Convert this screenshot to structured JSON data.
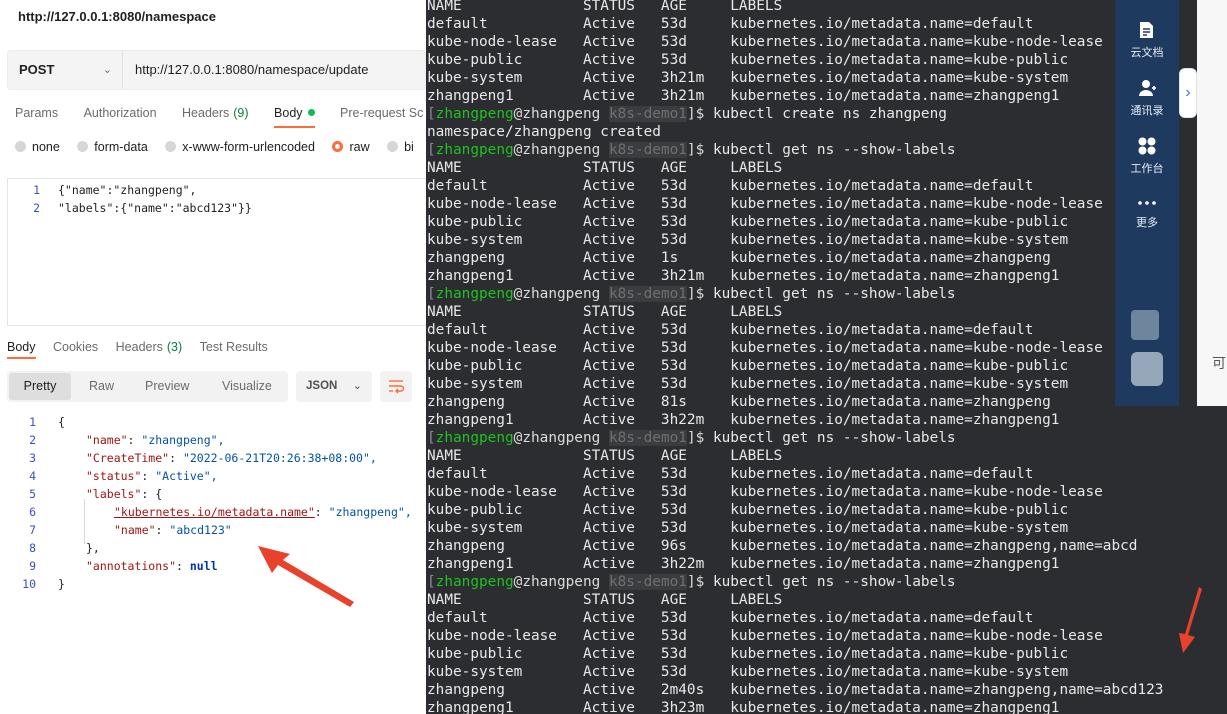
{
  "postman": {
    "request_title": "http://127.0.0.1:8080/namespace",
    "method": "POST",
    "url": "http://127.0.0.1:8080/namespace/update",
    "req_tabs": [
      {
        "label": "Params"
      },
      {
        "label": "Authorization"
      },
      {
        "label": "Headers",
        "count": "(9)"
      },
      {
        "label": "Body"
      },
      {
        "label": "Pre-request Sc"
      }
    ],
    "body_types": [
      "none",
      "form-data",
      "x-www-form-urlencoded",
      "raw",
      "bi"
    ],
    "body_type_selected": "raw",
    "body_lines": [
      {
        "n": "1",
        "text": "{\"name\":\"zhangpeng\","
      },
      {
        "n": "2",
        "text": "\"labels\":{\"name\":\"abcd123\"}}"
      }
    ],
    "resp_tabs": [
      {
        "label": "Body"
      },
      {
        "label": "Cookies"
      },
      {
        "label": "Headers",
        "count": "(3)"
      },
      {
        "label": "Test Results"
      }
    ],
    "view_modes": [
      "Pretty",
      "Raw",
      "Preview",
      "Visualize"
    ],
    "format": "JSON",
    "response_lines": [
      {
        "n": "1",
        "text": "{"
      },
      {
        "n": "2",
        "key": "\"name\"",
        "val": "\"zhangpeng\","
      },
      {
        "n": "3",
        "key": "\"CreateTime\"",
        "val": "\"2022-06-21T20:26:38+08:00\","
      },
      {
        "n": "4",
        "key": "\"status\"",
        "val": "\"Active\","
      },
      {
        "n": "5",
        "key": "\"labels\"",
        "val": "{"
      },
      {
        "n": "6",
        "key": "\"kubernetes.io/metadata.name\"",
        "val": "\"zhangpeng\","
      },
      {
        "n": "7",
        "key": "\"name\"",
        "val": "\"abcd123\""
      },
      {
        "n": "8",
        "text": "},"
      },
      {
        "n": "9",
        "key": "\"annotations\"",
        "val": "null"
      },
      {
        "n": "10",
        "text": "}"
      }
    ]
  },
  "terminal": {
    "lines": [
      {
        "t": "out",
        "text": "NAME              STATUS   AGE     LABELS"
      },
      {
        "t": "out",
        "text": "default           Active   53d     kubernetes.io/metadata.name=default"
      },
      {
        "t": "out",
        "text": "kube-node-lease   Active   53d     kubernetes.io/metadata.name=kube-node-lease"
      },
      {
        "t": "out",
        "text": "kube-public       Active   53d     kubernetes.io/metadata.name=kube-public"
      },
      {
        "t": "out",
        "text": "kube-system       Active   3h21m   kubernetes.io/metadata.name=kube-system"
      },
      {
        "t": "out",
        "text": "zhangpeng1        Active   3h21m   kubernetes.io/metadata.name=zhangpeng1"
      },
      {
        "t": "cmd",
        "cmd": "kubectl create ns zhangpeng"
      },
      {
        "t": "out",
        "text": "namespace/zhangpeng created"
      },
      {
        "t": "cmd",
        "cmd": "kubectl get ns --show-labels"
      },
      {
        "t": "out",
        "text": "NAME              STATUS   AGE     LABELS"
      },
      {
        "t": "out",
        "text": "default           Active   53d     kubernetes.io/metadata.name=default"
      },
      {
        "t": "out",
        "text": "kube-node-lease   Active   53d     kubernetes.io/metadata.name=kube-node-lease"
      },
      {
        "t": "out",
        "text": "kube-public       Active   53d     kubernetes.io/metadata.name=kube-public"
      },
      {
        "t": "out",
        "text": "kube-system       Active   53d     kubernetes.io/metadata.name=kube-system"
      },
      {
        "t": "out",
        "text": "zhangpeng         Active   1s      kubernetes.io/metadata.name=zhangpeng"
      },
      {
        "t": "out",
        "text": "zhangpeng1        Active   3h21m   kubernetes.io/metadata.name=zhangpeng1"
      },
      {
        "t": "cmd",
        "cmd": "kubectl get ns --show-labels"
      },
      {
        "t": "out",
        "text": "NAME              STATUS   AGE     LABELS"
      },
      {
        "t": "out",
        "text": "default           Active   53d     kubernetes.io/metadata.name=default"
      },
      {
        "t": "out",
        "text": "kube-node-lease   Active   53d     kubernetes.io/metadata.name=kube-node-lease"
      },
      {
        "t": "out",
        "text": "kube-public       Active   53d     kubernetes.io/metadata.name=kube-public"
      },
      {
        "t": "out",
        "text": "kube-system       Active   53d     kubernetes.io/metadata.name=kube-system"
      },
      {
        "t": "out",
        "text": "zhangpeng         Active   81s     kubernetes.io/metadata.name=zhangpeng"
      },
      {
        "t": "out",
        "text": "zhangpeng1        Active   3h22m   kubernetes.io/metadata.name=zhangpeng1"
      },
      {
        "t": "cmd",
        "cmd": "kubectl get ns --show-labels"
      },
      {
        "t": "out",
        "text": "NAME              STATUS   AGE     LABELS"
      },
      {
        "t": "out",
        "text": "default           Active   53d     kubernetes.io/metadata.name=default"
      },
      {
        "t": "out",
        "text": "kube-node-lease   Active   53d     kubernetes.io/metadata.name=kube-node-lease"
      },
      {
        "t": "out",
        "text": "kube-public       Active   53d     kubernetes.io/metadata.name=kube-public"
      },
      {
        "t": "out",
        "text": "kube-system       Active   53d     kubernetes.io/metadata.name=kube-system"
      },
      {
        "t": "out",
        "text": "zhangpeng         Active   96s     kubernetes.io/metadata.name=zhangpeng,name=abcd"
      },
      {
        "t": "out",
        "text": "zhangpeng1        Active   3h22m   kubernetes.io/metadata.name=zhangpeng1"
      },
      {
        "t": "cmd",
        "cmd": "kubectl get ns --show-labels"
      },
      {
        "t": "out",
        "text": "NAME              STATUS   AGE     LABELS"
      },
      {
        "t": "out",
        "text": "default           Active   53d     kubernetes.io/metadata.name=default"
      },
      {
        "t": "out",
        "text": "kube-node-lease   Active   53d     kubernetes.io/metadata.name=kube-node-lease"
      },
      {
        "t": "out",
        "text": "kube-public       Active   53d     kubernetes.io/metadata.name=kube-public"
      },
      {
        "t": "out",
        "text": "kube-system       Active   53d     kubernetes.io/metadata.name=kube-system"
      },
      {
        "t": "out",
        "text": "zhangpeng         Active   2m40s   kubernetes.io/metadata.name=zhangpeng,name=abcd123"
      },
      {
        "t": "out",
        "text": "zhangpeng1        Active   3h23m   kubernetes.io/metadata.name=zhangpeng1"
      },
      {
        "t": "cmd",
        "cmd": "",
        "cursor": true
      }
    ],
    "prompt": {
      "user": "zhangpeng",
      "host": "zhangpeng",
      "dir": "k8s-demo1"
    }
  },
  "side_panel": {
    "items": [
      {
        "label": "云文档",
        "icon": "cloud-doc-icon"
      },
      {
        "label": "通讯录",
        "icon": "contacts-icon"
      },
      {
        "label": "工作台",
        "icon": "workbench-icon"
      },
      {
        "label": "更多",
        "icon": "more-icon"
      }
    ],
    "expand_glyph": "›",
    "peek_text": "可"
  },
  "colors": {
    "accent": "#ff6c37",
    "terminal_bg": "#2b2d30",
    "prompt_user": "#1fc21f",
    "side_bg": "#1f3a5f",
    "arrow": "#e8412c"
  }
}
